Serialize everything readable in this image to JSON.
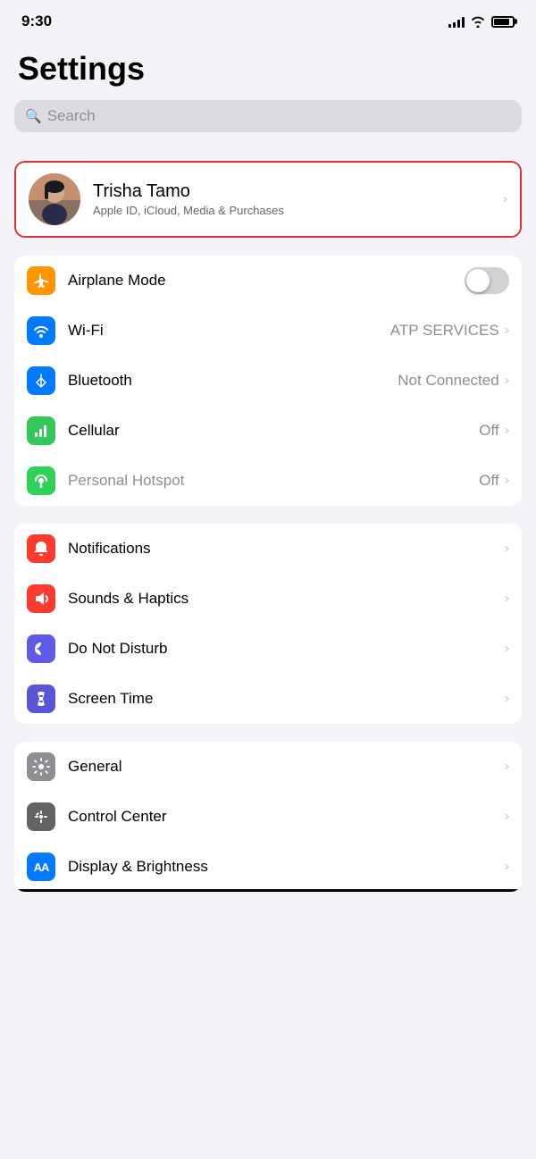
{
  "statusBar": {
    "time": "9:30",
    "signal_bars": [
      4,
      6,
      8,
      11,
      13
    ],
    "wifi": "wifi",
    "battery": 85
  },
  "page": {
    "title": "Settings",
    "search_placeholder": "Search"
  },
  "profile": {
    "name": "Trisha Tamo",
    "subtitle": "Apple ID, iCloud, Media & Purchases",
    "chevron": "›"
  },
  "connectivity_section": [
    {
      "id": "airplane",
      "label": "Airplane Mode",
      "icon_color": "icon-orange",
      "icon_symbol": "✈",
      "has_toggle": true,
      "toggle_on": false,
      "value": "",
      "has_chevron": false
    },
    {
      "id": "wifi",
      "label": "Wi-Fi",
      "icon_color": "icon-blue",
      "icon_symbol": "wifi",
      "has_toggle": false,
      "value": "ATP SERVICES",
      "has_chevron": true
    },
    {
      "id": "bluetooth",
      "label": "Bluetooth",
      "icon_color": "icon-blue-dark",
      "icon_symbol": "bluetooth",
      "has_toggle": false,
      "value": "Not Connected",
      "has_chevron": true
    },
    {
      "id": "cellular",
      "label": "Cellular",
      "icon_color": "icon-green",
      "icon_symbol": "cellular",
      "has_toggle": false,
      "value": "Off",
      "has_chevron": true
    },
    {
      "id": "hotspot",
      "label": "Personal Hotspot",
      "icon_color": "icon-green-light",
      "icon_symbol": "hotspot",
      "has_toggle": false,
      "value": "Off",
      "has_chevron": true,
      "label_dimmed": true
    }
  ],
  "notifications_section": [
    {
      "id": "notifications",
      "label": "Notifications",
      "icon_color": "icon-red-notif",
      "icon_symbol": "notif",
      "value": "",
      "has_chevron": true
    },
    {
      "id": "sounds",
      "label": "Sounds & Haptics",
      "icon_color": "icon-red-sounds",
      "icon_symbol": "sounds",
      "value": "",
      "has_chevron": true
    },
    {
      "id": "donotdisturb",
      "label": "Do Not Disturb",
      "icon_color": "icon-purple",
      "icon_symbol": "moon",
      "value": "",
      "has_chevron": true
    },
    {
      "id": "screentime",
      "label": "Screen Time",
      "icon_color": "icon-purple-dark",
      "icon_symbol": "hourglass",
      "value": "",
      "has_chevron": true
    }
  ],
  "general_section": [
    {
      "id": "general",
      "label": "General",
      "icon_color": "icon-gray",
      "icon_symbol": "gear",
      "value": "",
      "has_chevron": true
    },
    {
      "id": "controlcenter",
      "label": "Control Center",
      "icon_color": "icon-gray-mid",
      "icon_symbol": "sliders",
      "value": "",
      "has_chevron": true
    },
    {
      "id": "display",
      "label": "Display & Brightness",
      "icon_color": "icon-blue",
      "icon_symbol": "AA",
      "value": "",
      "has_chevron": true
    }
  ]
}
